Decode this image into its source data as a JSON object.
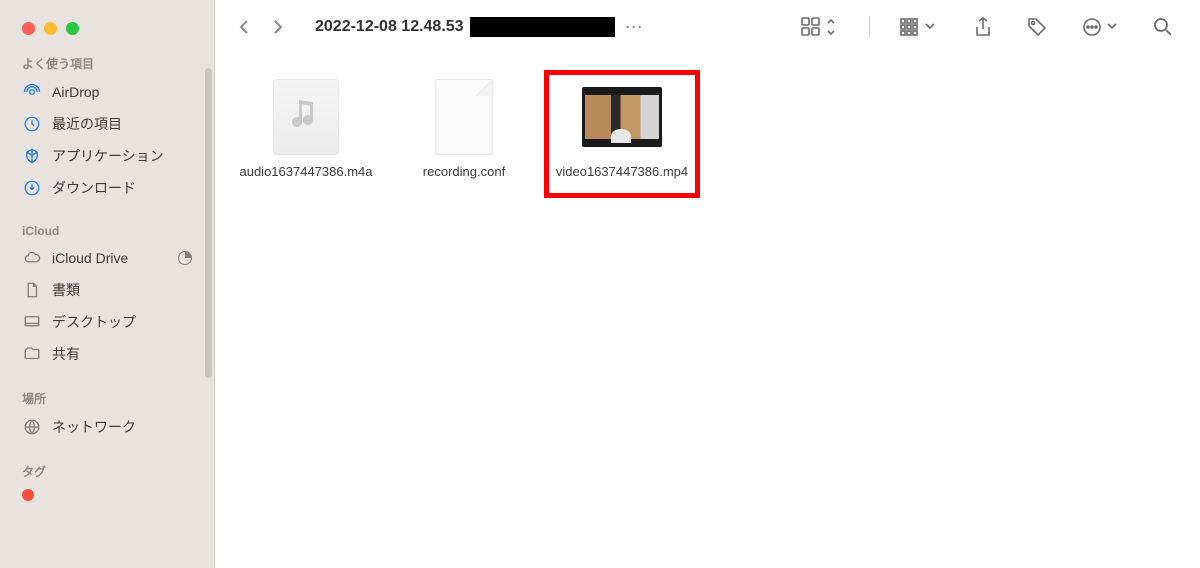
{
  "window": {
    "title": "2022-12-08 12.48.53"
  },
  "sidebar": {
    "sections": {
      "favorites": {
        "title": "よく使う項目",
        "items": [
          {
            "icon": "airdrop",
            "label": "AirDrop"
          },
          {
            "icon": "recent",
            "label": "最近の項目"
          },
          {
            "icon": "apps",
            "label": "アプリケーション"
          },
          {
            "icon": "downloads",
            "label": "ダウンロード"
          }
        ]
      },
      "icloud": {
        "title": "iCloud",
        "items": [
          {
            "icon": "cloud",
            "label": "iCloud Drive",
            "hasPie": true
          },
          {
            "icon": "doc",
            "label": "書類"
          },
          {
            "icon": "desktop",
            "label": "デスクトップ"
          },
          {
            "icon": "shared",
            "label": "共有"
          }
        ]
      },
      "locations": {
        "title": "場所",
        "items": [
          {
            "icon": "network",
            "label": "ネットワーク"
          }
        ]
      },
      "tags": {
        "title": "タグ"
      }
    }
  },
  "files": [
    {
      "type": "audio",
      "name": "audio1637447386.m4a"
    },
    {
      "type": "conf",
      "name": "recording.conf"
    },
    {
      "type": "video",
      "name": "video1637447386.mp4",
      "highlighted": true
    }
  ]
}
